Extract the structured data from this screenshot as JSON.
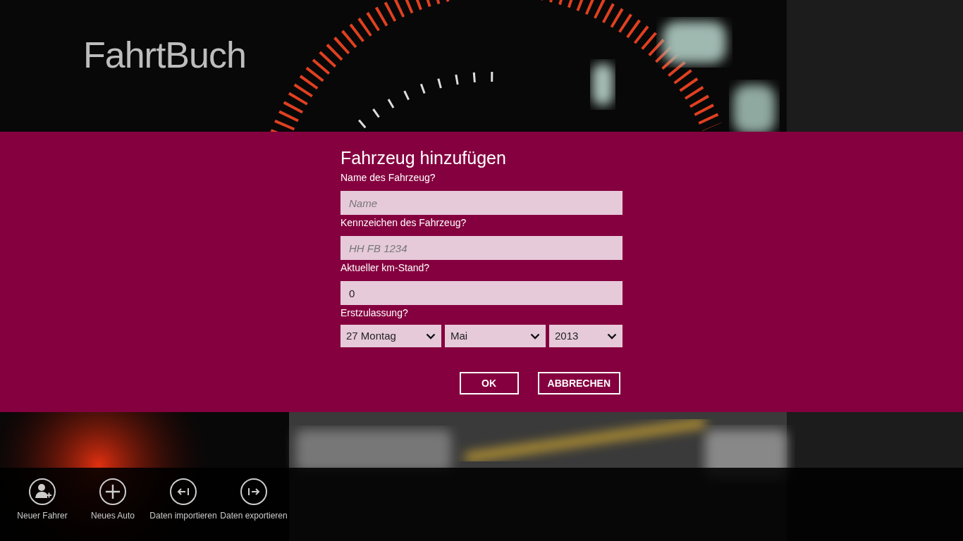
{
  "app": {
    "title": "FahrtBuch"
  },
  "dialog": {
    "title": "Fahrzeug hinzufügen",
    "fields": [
      {
        "kind": "text",
        "label": "Name des Fahrzeug?",
        "placeholder": "Name"
      },
      {
        "kind": "text",
        "label": "Kennzeichen des Fahrzeug?",
        "placeholder": "HH FB 1234"
      },
      {
        "kind": "text",
        "label": "Aktueller km-Stand?",
        "value": "0"
      },
      {
        "kind": "date",
        "label": "Erstzulassung?",
        "selects": [
          {
            "value": "27 Montag"
          },
          {
            "value": "Mai"
          },
          {
            "value": "2013"
          }
        ]
      }
    ],
    "buttons": [
      "OK",
      "ABBRECHEN"
    ]
  },
  "app_bar": {
    "commands": [
      {
        "kind": "add-person",
        "label": "Neuer Fahrer"
      },
      {
        "kind": "add",
        "label": "Neues Auto"
      },
      {
        "kind": "import",
        "label": "Daten importieren"
      },
      {
        "kind": "export",
        "label": "Daten exportieren"
      }
    ]
  }
}
